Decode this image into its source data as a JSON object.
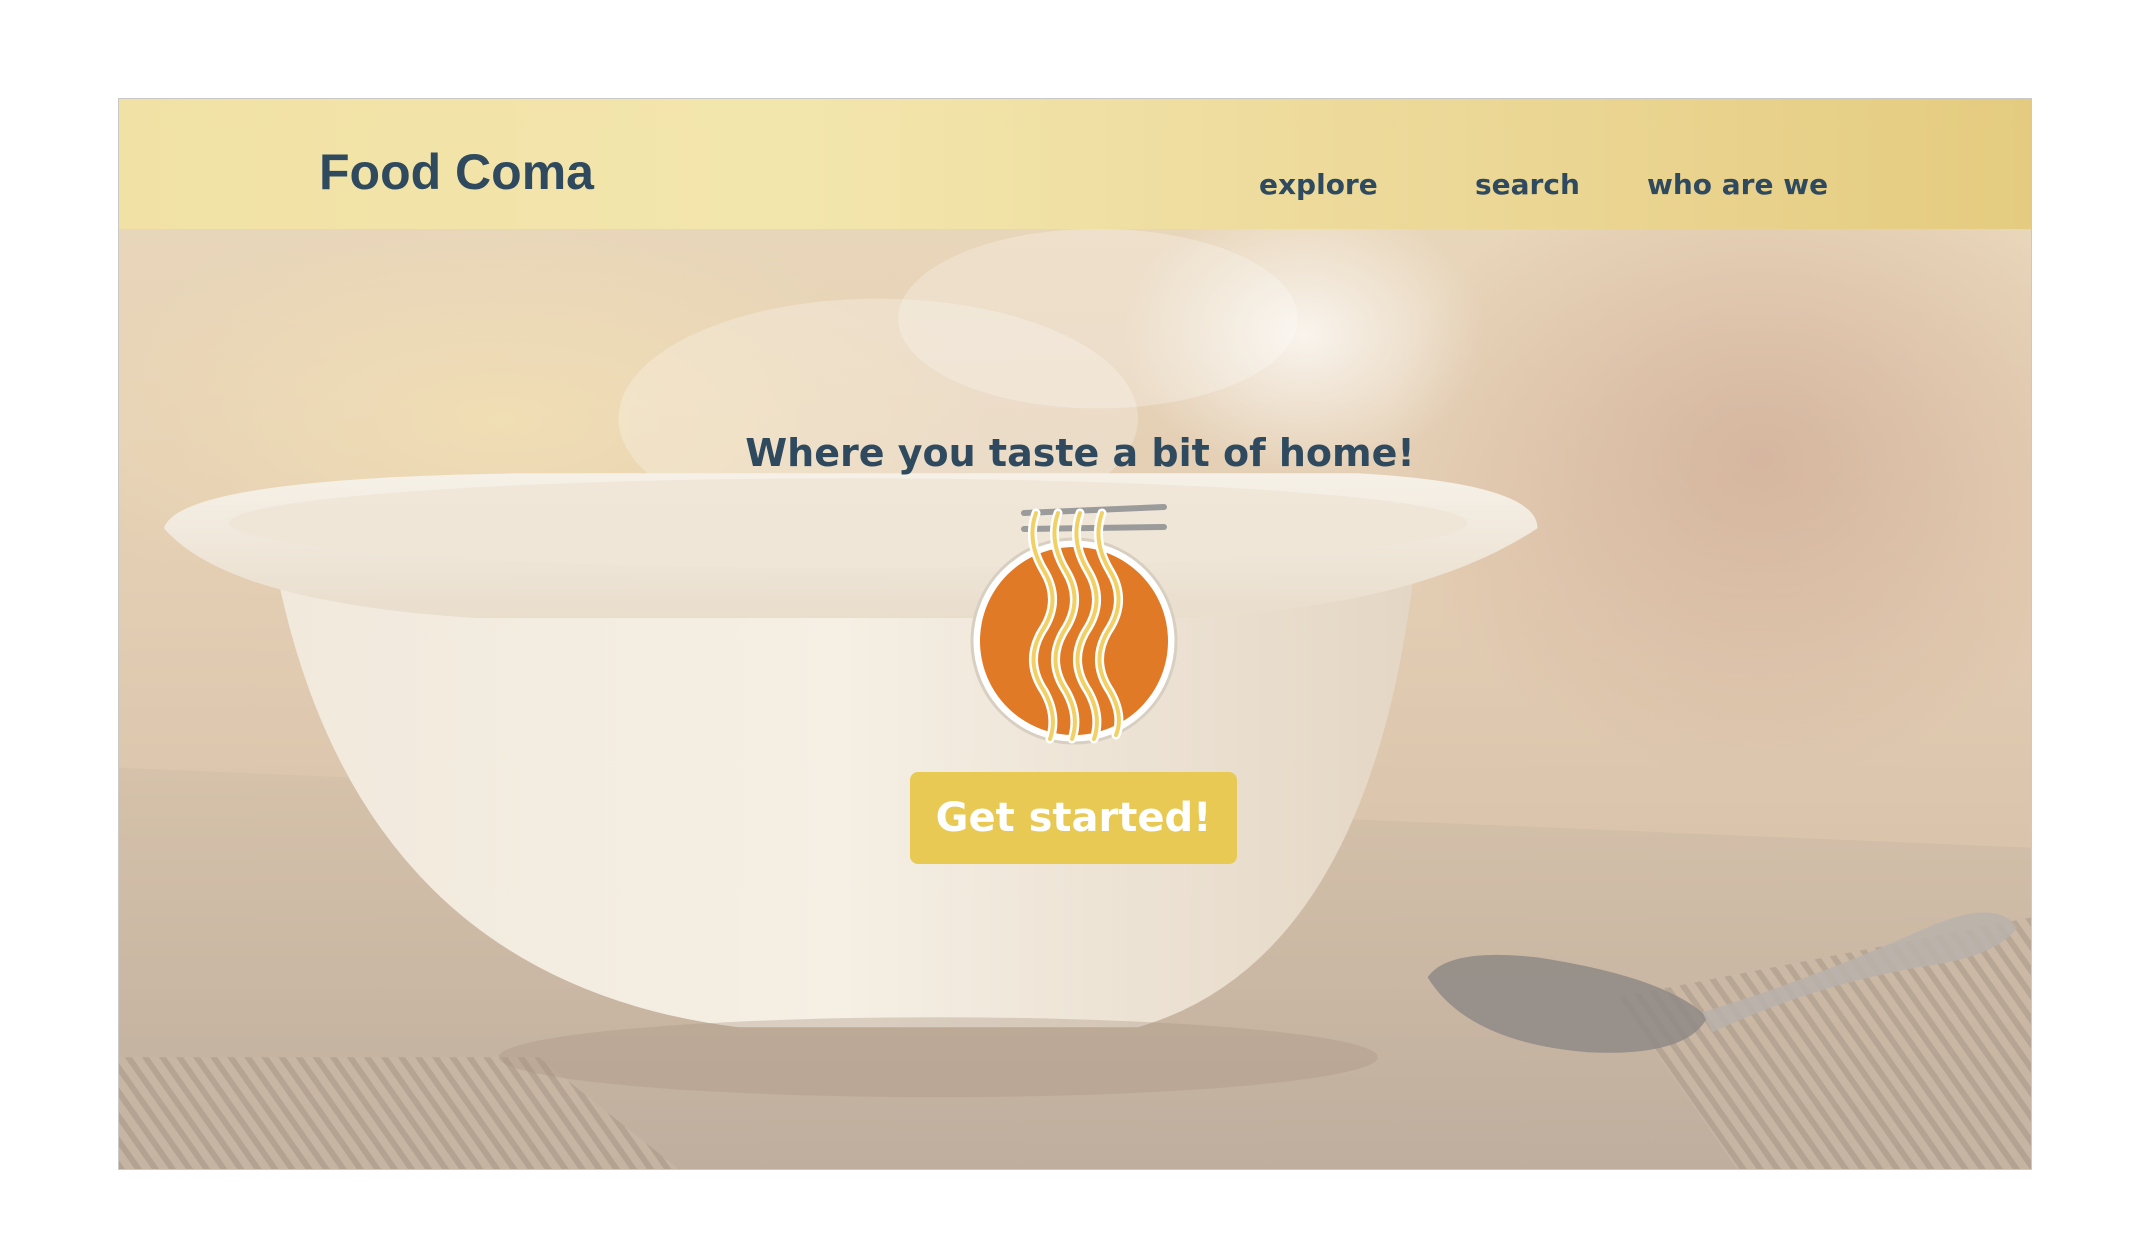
{
  "header": {
    "brand": "Food Coma",
    "nav": [
      {
        "label": "explore"
      },
      {
        "label": "search"
      },
      {
        "label": "who are we"
      }
    ]
  },
  "hero": {
    "tagline": "Where you taste a bit of home!",
    "cta_label": "Get started!",
    "logo_icon": "noodle-bowl-icon"
  },
  "colors": {
    "header_bg": "#f1e1a4",
    "text": "#2f4a5e",
    "accent_orange": "#e07a26",
    "button": "#e7c954",
    "noodles": "#f1d065",
    "chopsticks": "#9b9b9b"
  }
}
